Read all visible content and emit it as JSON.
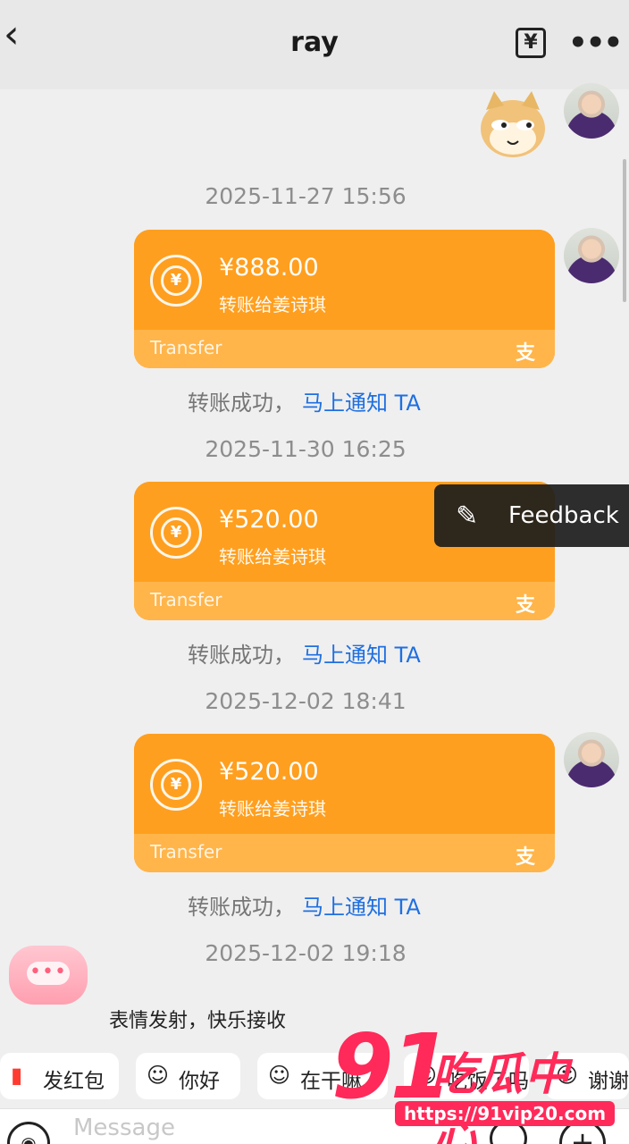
{
  "header": {
    "back_glyph": "‹",
    "title": "ray",
    "yen_glyph": "¥",
    "more_glyph": "•••"
  },
  "messages": [
    {
      "timestamp": "2025-11-27 15:56",
      "amount": "¥888.00",
      "recipient": "转账给姜诗琪",
      "footer": "Transfer",
      "status": "转账成功，",
      "status_link": "马上通知 TA"
    },
    {
      "timestamp": "2025-11-30 16:25",
      "amount": "¥520.00",
      "recipient": "转账给姜诗琪",
      "footer": "Transfer",
      "status": "转账成功，",
      "status_link": "马上通知 TA"
    },
    {
      "timestamp": "2025-12-02 18:41",
      "amount": "¥520.00",
      "recipient": "转账给姜诗琪",
      "footer": "Transfer",
      "status": "转账成功，",
      "status_link": "马上通知 TA"
    }
  ],
  "last_timestamp": "2025-12-02 19:18",
  "coin_symbol": "¥",
  "alipay_mark": "支",
  "feedback": {
    "label": "Feedback",
    "icon": "pencil-icon"
  },
  "promo_text": "表情发射，快乐接收",
  "quick_chips": [
    {
      "icon": "red-packet-icon",
      "label": "发红包"
    },
    {
      "icon": "greeting-emoji-icon",
      "label": "你好"
    },
    {
      "icon": "emoji-icon",
      "label": "在干嘛"
    },
    {
      "icon": "emoji-icon",
      "label": "吃饭了吗"
    },
    {
      "icon": "emoji-icon",
      "label": "谢谢"
    }
  ],
  "input": {
    "placeholder": "Message"
  },
  "watermark": {
    "number": "91",
    "text": "吃瓜中心",
    "url": "https://91vip20.com"
  },
  "colors": {
    "card": "#ff9f1a",
    "card_footer": "#ffb54a",
    "link": "#1f6fe0",
    "watermark": "#ff2a59"
  }
}
